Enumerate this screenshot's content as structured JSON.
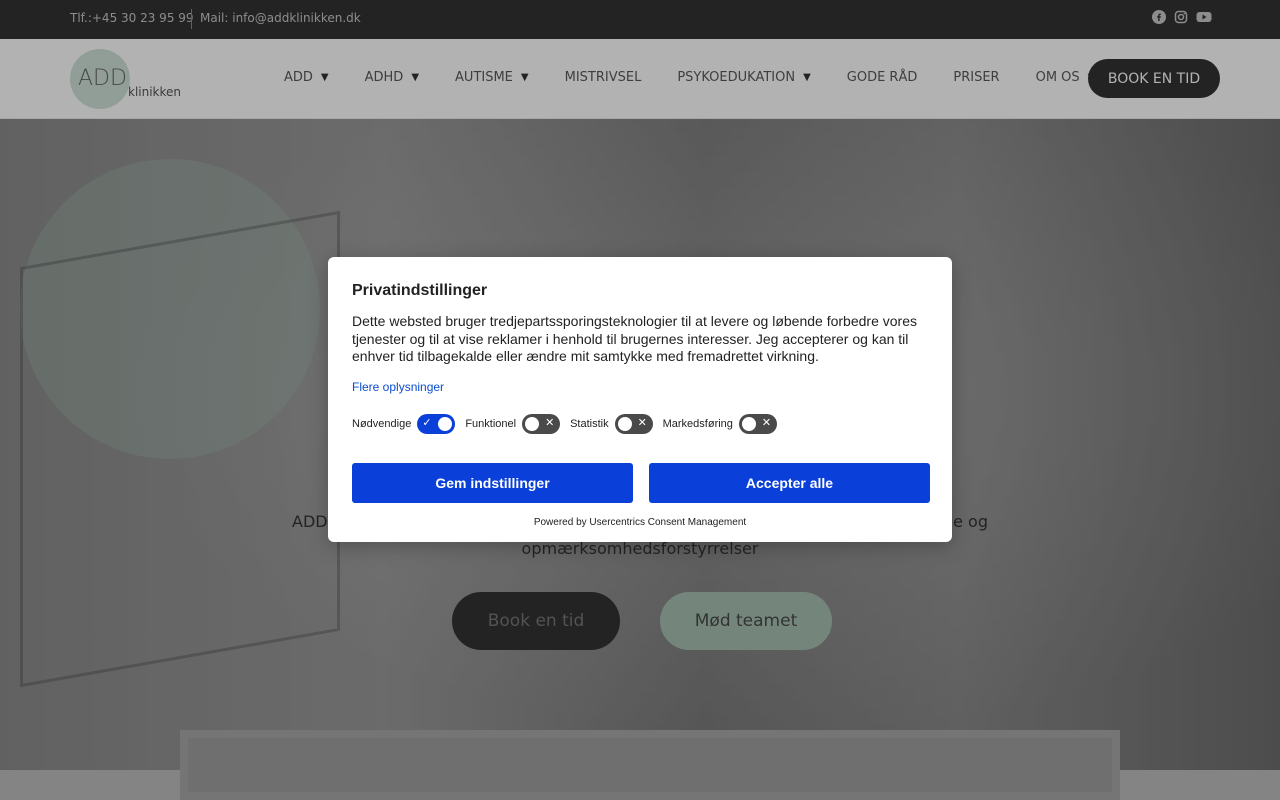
{
  "topbar": {
    "phone": "Tlf.:+45 30 23 95 99",
    "mail": "Mail: info@addklinikken.dk",
    "social_icons": [
      "facebook-icon",
      "instagram-icon",
      "youtube-icon"
    ]
  },
  "header": {
    "logo_add": "ADD",
    "logo_klinikken": "klinikken",
    "nav": [
      {
        "label": "ADD",
        "has_dropdown": true
      },
      {
        "label": "ADHD",
        "has_dropdown": true
      },
      {
        "label": "AUTISME",
        "has_dropdown": true
      },
      {
        "label": "MISTRIVSEL",
        "has_dropdown": false
      },
      {
        "label": "PSYKOEDUKATION",
        "has_dropdown": true
      },
      {
        "label": "GODE RÅD",
        "has_dropdown": false
      },
      {
        "label": "PRISER",
        "has_dropdown": false
      },
      {
        "label": "OM OS",
        "has_dropdown": true
      }
    ],
    "book_button": "BOOK EN TID"
  },
  "hero": {
    "subtext_line1": "ADD",
    "subtext_line1_end": "ne og",
    "subtext_line2": "opmærksomhedsforstyrrelser",
    "btn_book": "Book en tid",
    "btn_team": "Mød teamet"
  },
  "consent": {
    "title": "Privatindstillinger",
    "body": "Dette websted bruger tredjepartssporingsteknologier til at levere og løbende forbedre vores tjenester og til at vise reklamer i henhold til brugernes interesser. Jeg accepterer og kan til enhver tid tilbagekalde eller ændre mit samtykke med fremadrettet virkning.",
    "more_info": "Flere oplysninger",
    "toggles": [
      {
        "label": "Nødvendige",
        "on": true
      },
      {
        "label": "Funktionel",
        "on": false
      },
      {
        "label": "Statistik",
        "on": false
      },
      {
        "label": "Markedsføring",
        "on": false
      }
    ],
    "save_button": "Gem indstillinger",
    "accept_button": "Accepter alle",
    "powered_by": "Powered by Usercentrics Consent Management",
    "accent_color": "#0a3fd9"
  }
}
